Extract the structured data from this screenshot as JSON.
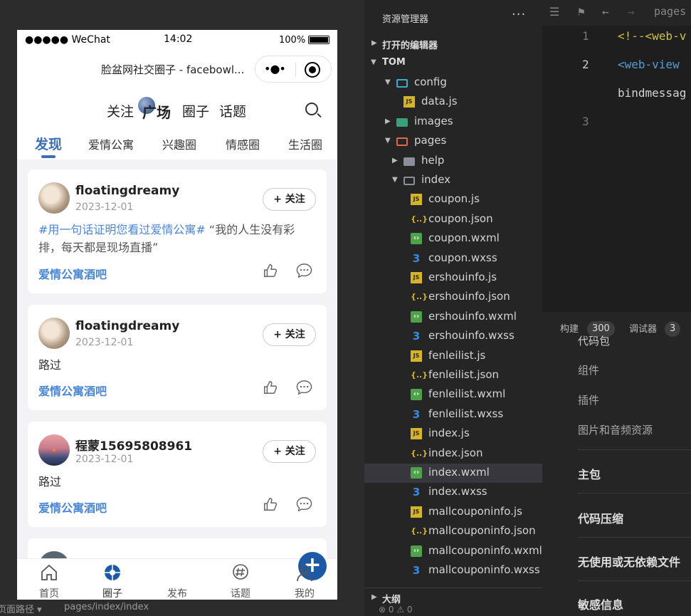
{
  "simulator": {
    "status_bar": {
      "signal": "●●●●● WeChat",
      "time": "14:02",
      "battery": "100%"
    },
    "title": "脸盆网社交圈子 - facebowl...",
    "capsule": {
      "more": "•●•"
    },
    "top_nav": [
      "关注",
      "广场",
      "圈子",
      "话题"
    ],
    "tabs": [
      "发现",
      "爱情公寓",
      "兴趣圈",
      "情感圈",
      "生活圈"
    ],
    "posts": [
      {
        "user": "floatingdreamy",
        "date": "2023-12-01",
        "follow": "+ 关注",
        "hashtag": "#用一句话证明您看过爱情公寓#",
        "text": "“我的人生没有彩排，每天都是现场直播”",
        "circle": "爱情公寓酒吧"
      },
      {
        "user": "floatingdreamy",
        "date": "2023-12-01",
        "follow": "+ 关注",
        "text": "路过",
        "circle": "爱情公寓酒吧"
      },
      {
        "user": "程蒙15695808961",
        "date": "2023-12-01",
        "follow": "+ 关注",
        "text": "路过",
        "circle": "爱情公寓酒吧"
      }
    ],
    "tabbar": [
      "首页",
      "圈子",
      "发布",
      "话题",
      "我的"
    ],
    "bottom_bar": {
      "path_label": "页面路径 ▾",
      "path": "pages/index/index"
    }
  },
  "explorer": {
    "title": "资源管理器",
    "more": "···",
    "sections": {
      "open_editors": "打开的编辑器",
      "project": "TOM",
      "outline": "大纲"
    },
    "tree": [
      {
        "name": "config",
        "type": "folder-open"
      },
      {
        "name": "data.js",
        "type": "js"
      },
      {
        "name": "images",
        "type": "folder"
      },
      {
        "name": "pages",
        "type": "folder-open"
      },
      {
        "name": "help",
        "type": "folder"
      },
      {
        "name": "index",
        "type": "folder-open"
      },
      {
        "name": "coupon.js",
        "type": "js"
      },
      {
        "name": "coupon.json",
        "type": "json"
      },
      {
        "name": "coupon.wxml",
        "type": "wxml"
      },
      {
        "name": "coupon.wxss",
        "type": "wxss"
      },
      {
        "name": "ershouinfo.js",
        "type": "js"
      },
      {
        "name": "ershouinfo.json",
        "type": "json"
      },
      {
        "name": "ershouinfo.wxml",
        "type": "wxml"
      },
      {
        "name": "ershouinfo.wxss",
        "type": "wxss"
      },
      {
        "name": "fenleilist.js",
        "type": "js"
      },
      {
        "name": "fenleilist.json",
        "type": "json"
      },
      {
        "name": "fenleilist.wxml",
        "type": "wxml"
      },
      {
        "name": "fenleilist.wxss",
        "type": "wxss"
      },
      {
        "name": "index.js",
        "type": "js"
      },
      {
        "name": "index.json",
        "type": "json"
      },
      {
        "name": "index.wxml",
        "type": "wxml",
        "selected": true
      },
      {
        "name": "index.wxss",
        "type": "wxss"
      },
      {
        "name": "mallcouponinfo.js",
        "type": "js"
      },
      {
        "name": "mallcouponinfo.json",
        "type": "json"
      },
      {
        "name": "mallcouponinfo.wxml",
        "type": "wxml"
      },
      {
        "name": "mallcouponinfo.wxss",
        "type": "wxss"
      }
    ]
  },
  "editor": {
    "breadcrumb": "pages",
    "lines": [
      {
        "num": "1",
        "code": "<!--<web-v"
      },
      {
        "num": "2",
        "code": "<web-view"
      },
      {
        "num": "",
        "code": "bindmessag"
      },
      {
        "num": "3",
        "code": ""
      }
    ]
  },
  "panel": {
    "tabs": [
      {
        "label": "构建",
        "count": "300"
      },
      {
        "label": "调试器",
        "count": "3"
      }
    ],
    "partial_top": "代码包",
    "items": [
      "组件",
      "插件",
      "图片和音频资源"
    ],
    "headings": [
      "主包",
      "代码压缩",
      "无使用或无依赖文件",
      "敏感信息"
    ],
    "status": "⊗ 0 ⚠ 0"
  },
  "colors": {
    "accent": "#3b6fb6",
    "link": "#4a86d6",
    "publish": "#1d5aa6",
    "ide_bg": "#252526"
  }
}
